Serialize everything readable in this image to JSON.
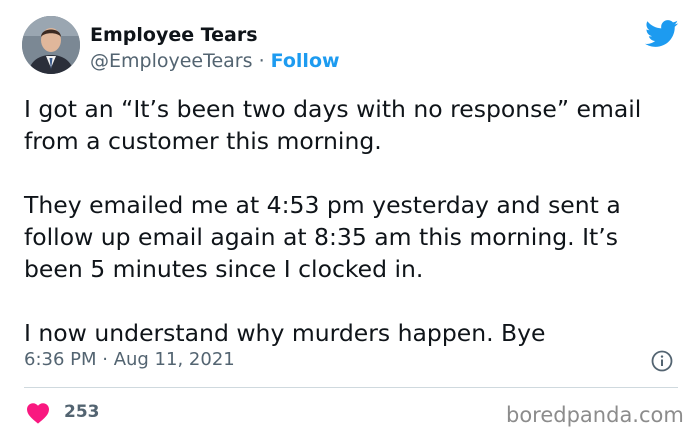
{
  "author": {
    "display_name": "Employee Tears",
    "handle": "@EmployeeTears",
    "separator": " · ",
    "follow_label": "Follow"
  },
  "tweet": {
    "paragraphs": [
      "I got an “It’s been two days with no response” email from a customer this morning.",
      "They emailed me at 4:53 pm yesterday and sent a follow up email again at 8:35 am this morning. It’s been 5 minutes since I clocked in.",
      "I now understand why murders happen. Bye"
    ],
    "timestamp": "6:36 PM · Aug 11, 2021",
    "like_count": "253"
  },
  "icons": {
    "platform": "twitter-bird-icon",
    "info": "info-icon",
    "like": "heart-icon"
  },
  "colors": {
    "accent": "#1d9bf0",
    "heart": "#f91880",
    "secondary_text": "#536471",
    "divider": "#cfd9de"
  },
  "watermark": "boredpanda.com"
}
